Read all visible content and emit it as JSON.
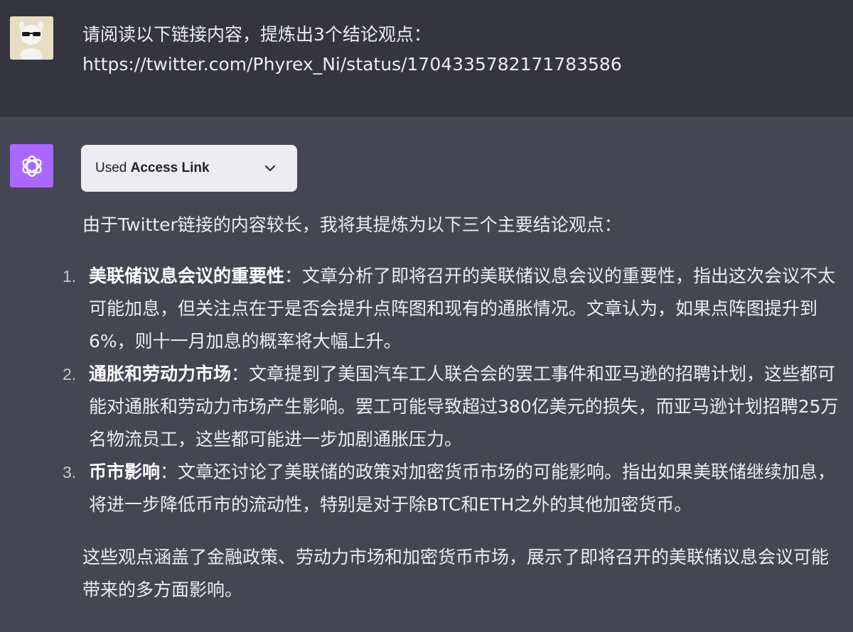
{
  "user": {
    "line1": "请阅读以下链接内容，提炼出3个结论观点：",
    "line2": "https://twitter.com/Phyrex_Ni/status/1704335782171783586"
  },
  "assistant": {
    "tool": {
      "used_label": "Used",
      "plugin_name": "Access Link"
    },
    "intro": "由于Twitter链接的内容较长，我将其提炼为以下三个主要结论观点：",
    "items": [
      {
        "number": "1.",
        "title": "美联储议息会议的重要性",
        "separator": "：",
        "body": "文章分析了即将召开的美联储议息会议的重要性，指出这次会议不太可能加息，但关注点在于是否会提升点阵图和现有的通胀情况。文章认为，如果点阵图提升到6%，则十一月加息的概率将大幅上升。"
      },
      {
        "number": "2.",
        "title": "通胀和劳动力市场",
        "separator": "：",
        "body": "文章提到了美国汽车工人联合会的罢工事件和亚马逊的招聘计划，这些都可能对通胀和劳动力市场产生影响。罢工可能导致超过380亿美元的损失，而亚马逊计划招聘25万名物流员工，这些都可能进一步加剧通胀压力。"
      },
      {
        "number": "3.",
        "title": "币市影响",
        "separator": "：",
        "body": "文章还讨论了美联储的政策对加密货币市场的可能影响。指出如果美联储继续加息，将进一步降低币市的流动性，特别是对于除BTC和ETH之外的其他加密货币。"
      }
    ],
    "closing": "这些观点涵盖了金融政策、劳动力市场和加密货币市场，展示了即将召开的美联储议息会议可能带来的多方面影响。"
  }
}
